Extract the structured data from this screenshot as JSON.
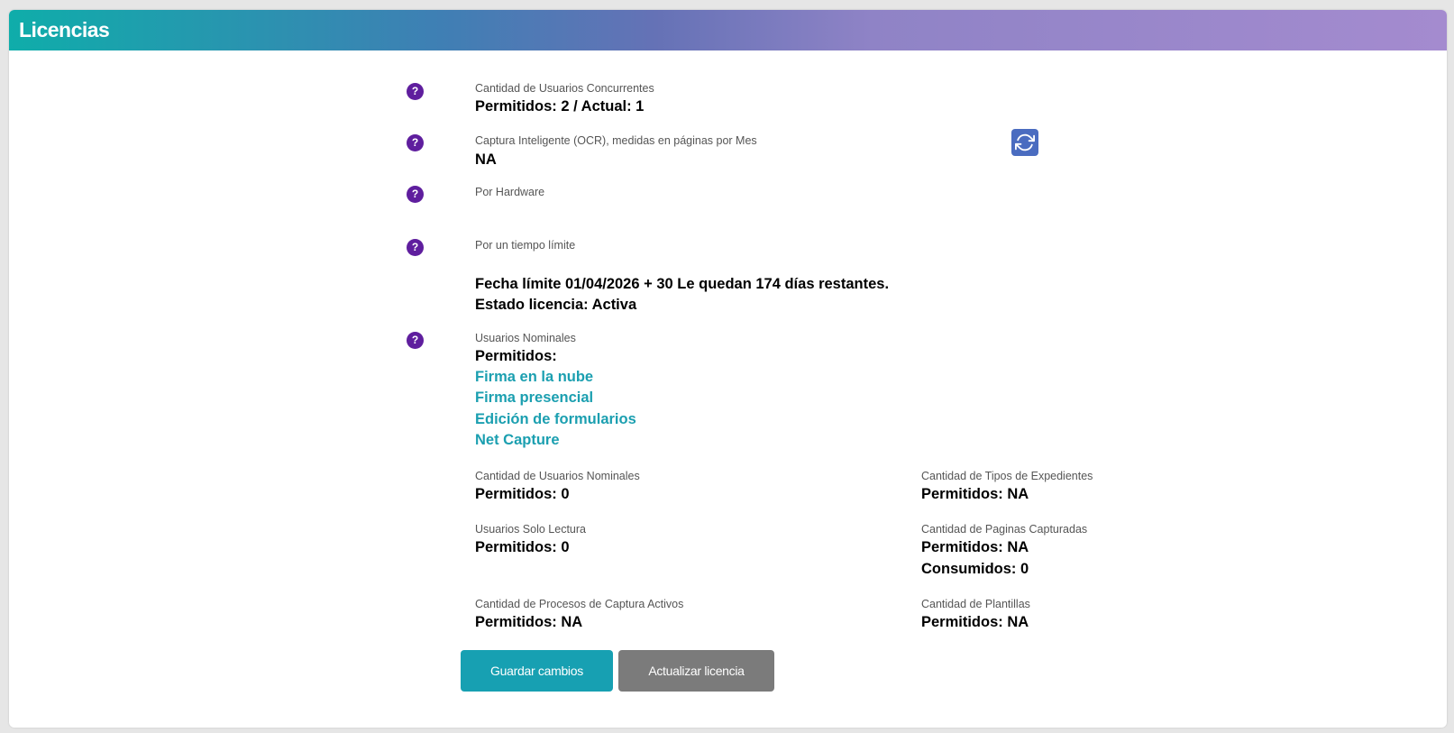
{
  "header": {
    "title": "Licencias"
  },
  "sections": {
    "concurrent": {
      "label": "Cantidad de Usuarios Concurrentes",
      "value": "Permitidos: 2 / Actual: 1"
    },
    "ocr": {
      "label": "Captura Inteligente (OCR), medidas en páginas por Mes",
      "value": "NA"
    },
    "hardware": {
      "label": "Por Hardware"
    },
    "time_limit": {
      "label": "Por un tiempo límite",
      "deadline": "Fecha límite 01/04/2026 + 30 Le quedan 174 días restantes.",
      "status": "Estado licencia: Activa"
    },
    "nominal": {
      "label": "Usuarios Nominales",
      "value": "Permitidos:",
      "links": [
        "Firma en la nube",
        "Firma presencial",
        "Edición de formularios",
        "Net Capture"
      ]
    }
  },
  "grid": {
    "nominal_count": {
      "label": "Cantidad de Usuarios Nominales",
      "value": "Permitidos: 0"
    },
    "read_only": {
      "label": "Usuarios Solo Lectura",
      "value": "Permitidos: 0"
    },
    "capture_processes": {
      "label": "Cantidad de Procesos de Captura Activos",
      "value": "Permitidos: NA"
    },
    "file_types": {
      "label": "Cantidad de Tipos de Expedientes",
      "value": "Permitidos: NA"
    },
    "captured_pages": {
      "label": "Cantidad de Paginas Capturadas",
      "value": "Permitidos: NA",
      "consumed": "Consumidos: 0"
    },
    "templates": {
      "label": "Cantidad de Plantillas",
      "value": "Permitidos: NA"
    }
  },
  "help_icon": {
    "glyph": "?"
  },
  "buttons": {
    "save": "Guardar cambios",
    "update": "Actualizar licencia"
  },
  "colors": {
    "help": "#5f1e9e",
    "link": "#1b9fb0",
    "save_button": "#17a0b2",
    "update_button": "#7b7b7b",
    "refresh_button": "#4a6cc0"
  }
}
